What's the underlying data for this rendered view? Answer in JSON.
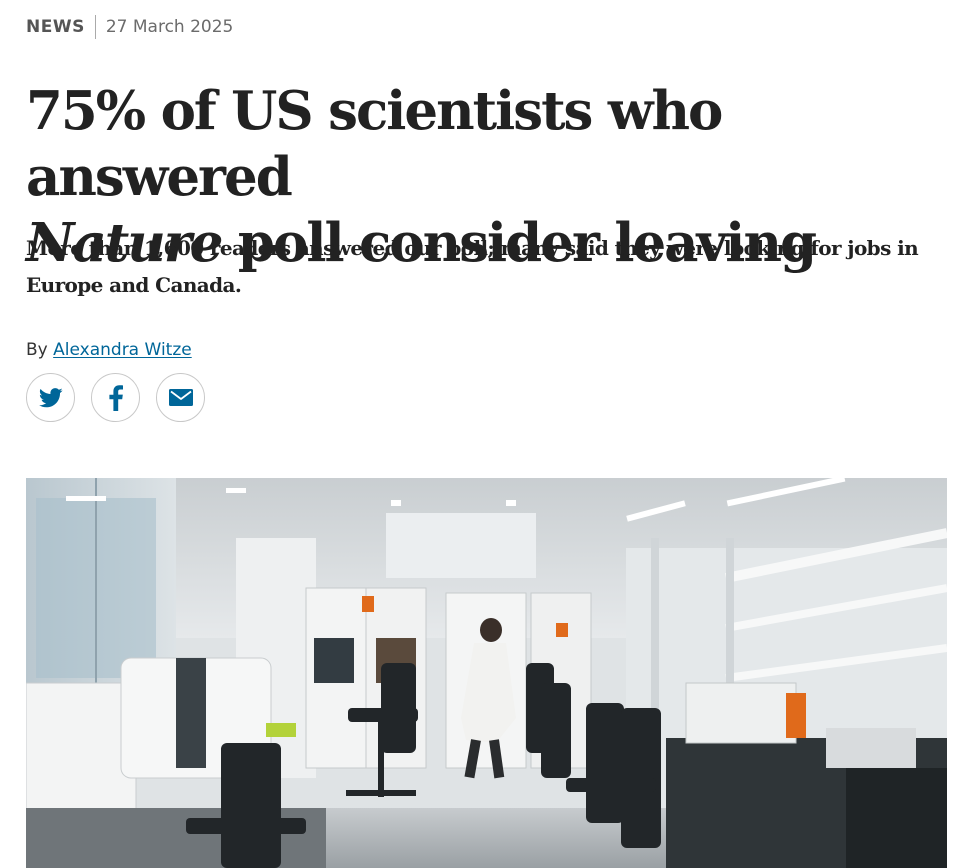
{
  "article": {
    "type": "NEWS",
    "date": "27 March 2025",
    "title_part1": "75% of US scientists who answered",
    "title_italic": "Nature",
    "title_part2": " poll consider leaving",
    "standfirst": "More than 1,600 readers answered our poll; many said they were looking for jobs in Europe and Canada.",
    "byline_prefix": "By",
    "author": "Alexandra Witze"
  },
  "share": {
    "buttons": [
      {
        "icon": "twitter-bird-icon",
        "color": "#006699"
      },
      {
        "icon": "facebook-f-icon",
        "color": "#006699"
      },
      {
        "icon": "envelope-icon",
        "color": "#006699"
      }
    ]
  },
  "hero_image": {
    "subject": "laboratory-photo"
  },
  "colors": {
    "link": "#006699",
    "text": "#222222",
    "meta": "#666666"
  }
}
